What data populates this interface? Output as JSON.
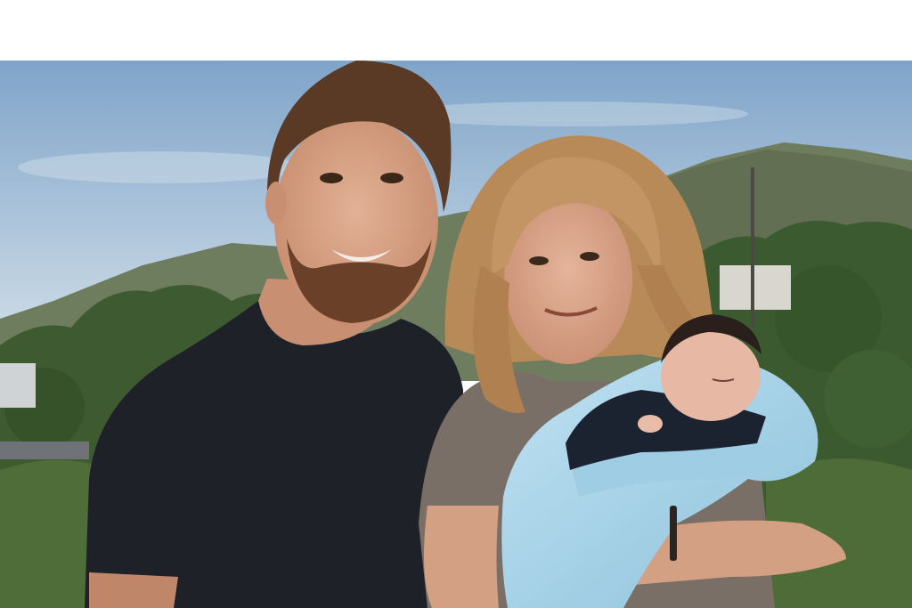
{
  "page": {
    "background": "#ffffff"
  },
  "photo": {
    "subjects": [
      "bearded-man",
      "woman",
      "newborn-baby"
    ],
    "palette": {
      "sky_top": "#7fa4c9",
      "sky_bottom": "#cddde9",
      "mountain": "#6f7d5f",
      "trees": "#3d5a31",
      "hedge": "#4f6d38",
      "shirt_man": "#1e2228",
      "shirt_woman": "#7a6f66",
      "blanket": "#a9d3e8",
      "skin": "#d9a58a",
      "hair_man": "#5a3a24",
      "hair_woman": "#b88a58"
    }
  }
}
